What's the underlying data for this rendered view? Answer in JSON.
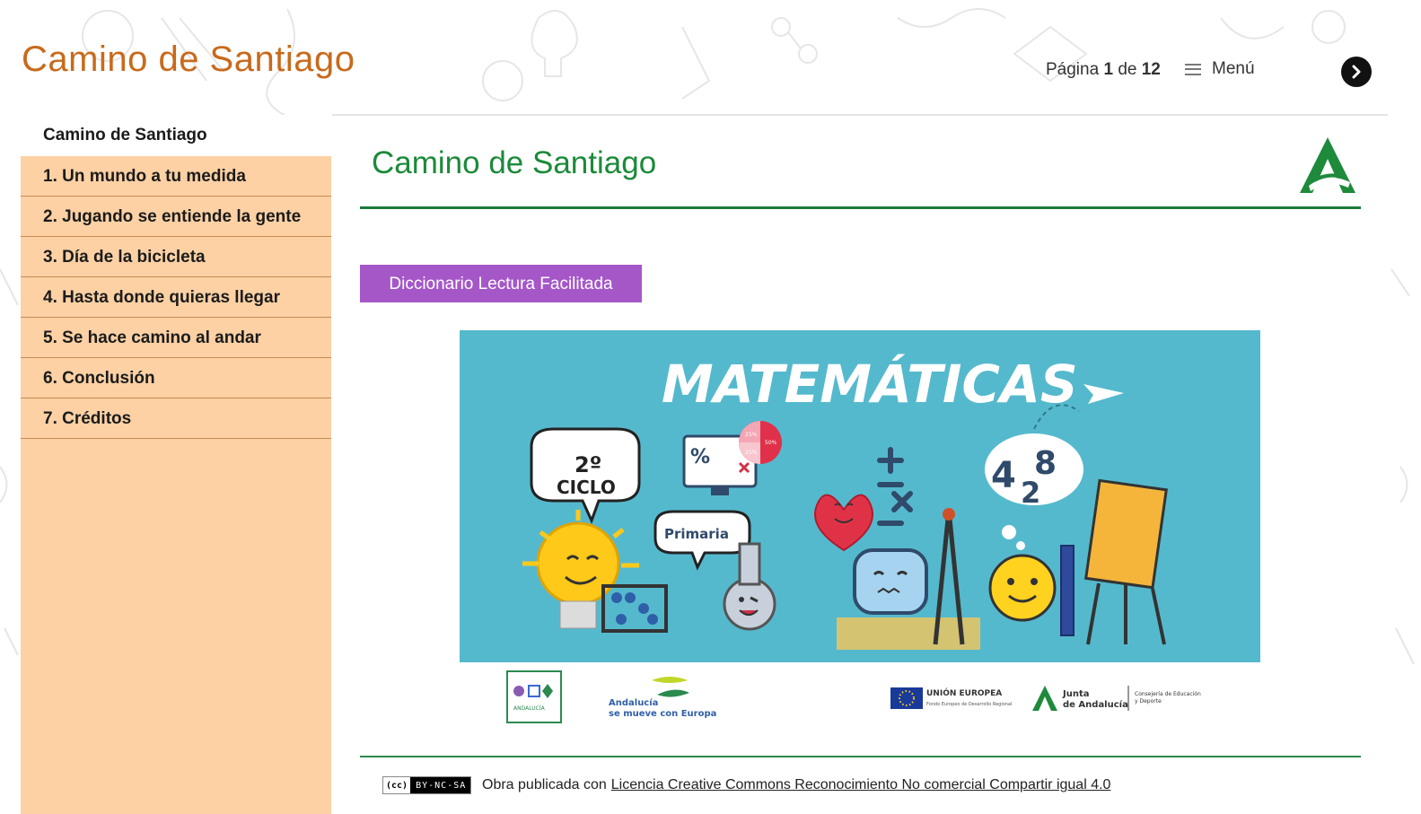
{
  "header": {
    "site_title": "Camino de Santiago",
    "pager_prefix": "Página",
    "current_page": "1",
    "pager_of": "de",
    "total_pages": "12",
    "menu_label": "Menú"
  },
  "sidebar": {
    "items": [
      {
        "label": "Camino de Santiago"
      },
      {
        "label": "1. Un mundo a tu medida"
      },
      {
        "label": "2. Jugando se entiende la gente"
      },
      {
        "label": "3. Día de la bicicleta"
      },
      {
        "label": "4. Hasta donde quieras llegar"
      },
      {
        "label": "5. Se hace camino al andar"
      },
      {
        "label": "6. Conclusión"
      },
      {
        "label": "7. Créditos"
      }
    ]
  },
  "main": {
    "heading": "Camino de Santiago",
    "dict_button": "Diccionario Lectura Facilitada",
    "banner": {
      "title": "MATEMÁTICAS",
      "cycle_num": "2º",
      "cycle_word": "CICLO",
      "level": "Primaria",
      "pct_symbol": "%",
      "numbers": "4",
      "numbers2": "2",
      "numbers3": "8",
      "pie_a": "25%",
      "pie_b": "50%",
      "pie_c": "25%"
    },
    "logos": {
      "rea_text": "ANDALUCÍA",
      "andalucia_line1": "Andalucía",
      "andalucia_line2": "se mueve con Europa",
      "ue_title": "UNIÓN EUROPEA",
      "ue_sub": "Fondo Europeo de Desarrollo Regional",
      "junta_line1": "Junta",
      "junta_line2": "de Andalucía",
      "consejeria_line1": "Consejería de Educación",
      "consejeria_line2": "y Deporte"
    },
    "license": {
      "badge_text": "BY-NC-SA",
      "cc_text": "(cc)",
      "prefix": "Obra publicada con",
      "link_text": "Licencia Creative Commons Reconocimiento No comercial Compartir igual 4.0"
    }
  },
  "colors": {
    "title_orange": "#c86a1c",
    "sidebar_bg": "#fdd1a4",
    "heading_green": "#1b8a3a",
    "dict_purple": "#a557c8",
    "banner_teal": "#55b9cd"
  }
}
